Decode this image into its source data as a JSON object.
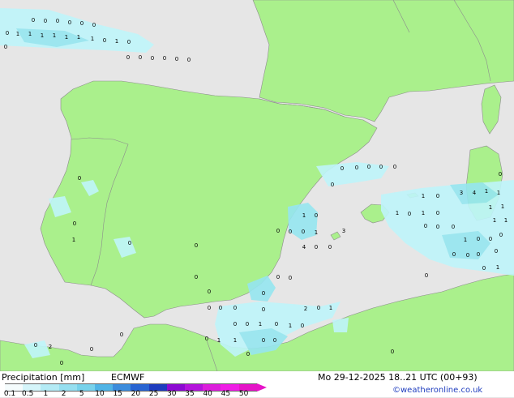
{
  "map": {
    "colors": {
      "sea": "#e6e6e6",
      "land": "#aaf08c",
      "border": "#8c8c8c",
      "precip_light": "#bff5fa",
      "precip_mid": "#96e6f0"
    },
    "point_values": [
      "0",
      "0",
      "0",
      "0",
      "0",
      "0",
      "0",
      "1",
      "1",
      "1",
      "1",
      "1",
      "1",
      "1",
      "0",
      "1",
      "0",
      "0",
      "0",
      "0",
      "0",
      "0",
      "0",
      "0",
      "0",
      "0",
      "0",
      "0",
      "0",
      "0",
      "0",
      "0",
      "3",
      "4",
      "1",
      "1",
      "0",
      "1",
      "1",
      "1",
      "1",
      "1",
      "1",
      "0",
      "1",
      "0",
      "0",
      "0",
      "0",
      "1",
      "0",
      "0",
      "0",
      "0",
      "0",
      "0",
      "0",
      "0",
      "1",
      "0",
      "1",
      "0",
      "0",
      "0",
      "0",
      "1",
      "4",
      "0",
      "0",
      "3",
      "1",
      "0",
      "0",
      "0",
      "0",
      "0",
      "0",
      "0",
      "0",
      "0",
      "0",
      "0",
      "2",
      "0",
      "1",
      "0",
      "0",
      "1",
      "0",
      "1",
      "0",
      "0",
      "1",
      "1",
      "0",
      "0",
      "0",
      "0",
      "0",
      "0",
      "0",
      "2",
      "0",
      "0",
      "0",
      "0",
      "0",
      "0",
      "0",
      "0",
      "0"
    ]
  },
  "legend": {
    "title": "Precipitation [mm]",
    "model": "ECMWF",
    "datetime": "Mo 29-12-2025 18..21 UTC (00+93)",
    "credit": "©weatheronline.co.uk",
    "scale_labels": [
      "0.1",
      "0.5",
      "1",
      "2",
      "5",
      "10",
      "15",
      "20",
      "25",
      "30",
      "35",
      "40",
      "45",
      "50"
    ],
    "scale_colors": [
      "#f5fcfd",
      "#d5f5fa",
      "#b4ebf5",
      "#96dff0",
      "#78d2eb",
      "#50b4e6",
      "#3c8cdc",
      "#2864d2",
      "#1e3cbe",
      "#8c0ad2",
      "#b414dc",
      "#dc1edc",
      "#f01ee6",
      "#e614c8"
    ]
  }
}
